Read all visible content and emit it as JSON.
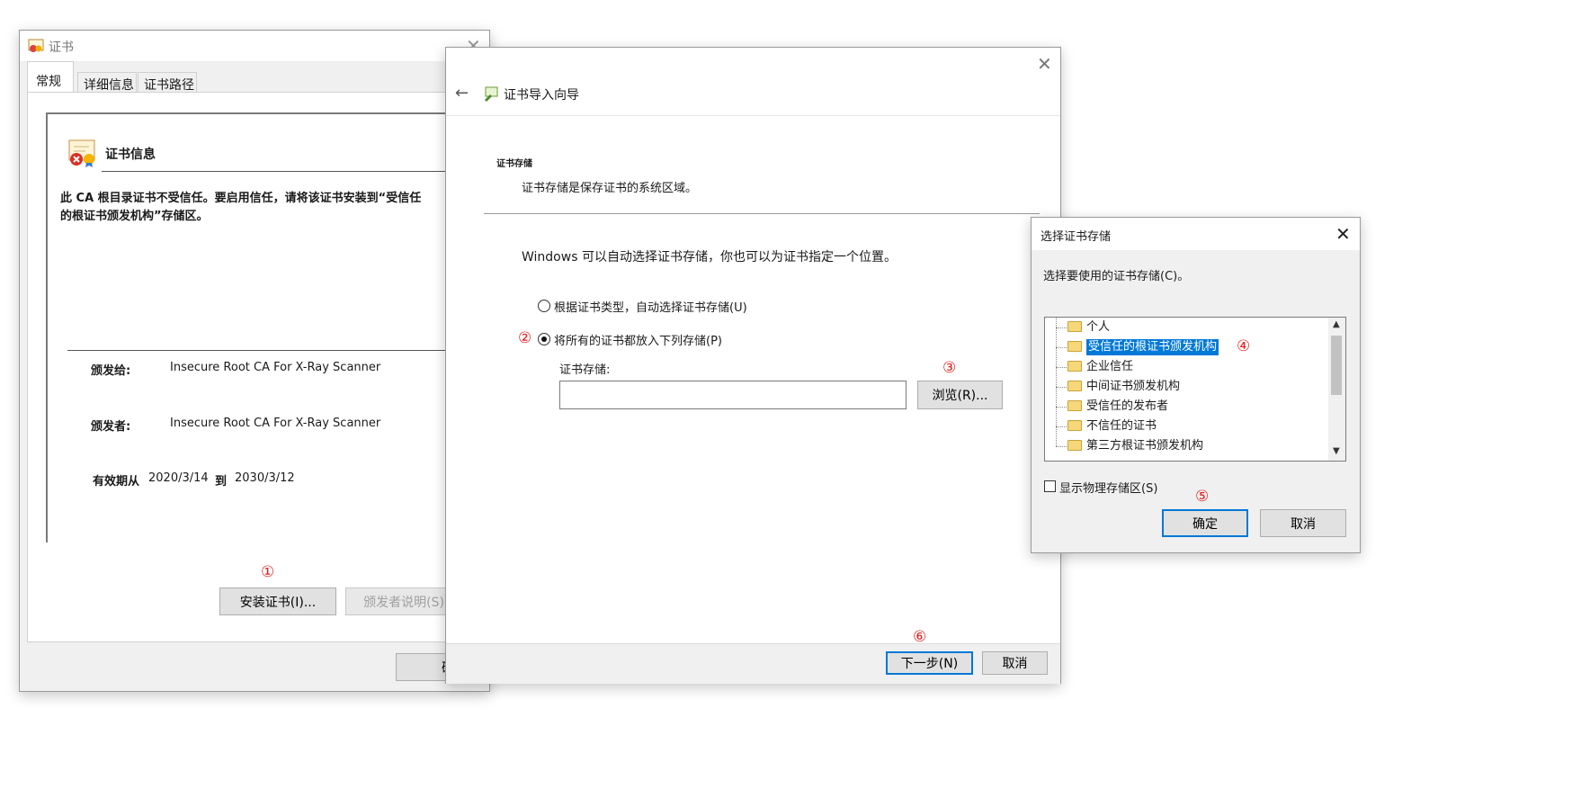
{
  "cert_window": {
    "title": "证书",
    "tabs": [
      "常规",
      "详细信息",
      "证书路径"
    ],
    "heading": "证书信息",
    "warning": "此 CA 根目录证书不受信任。要启用信任，请将该证书安装到“受信任的根证书颁发机构”存储区。",
    "issued_to_label": "颁发给:",
    "issued_to_value": "Insecure Root CA For X-Ray Scanner",
    "issued_by_label": "颁发者:",
    "issued_by_value": "Insecure Root CA For X-Ray Scanner",
    "valid_from_label": "有效期从",
    "valid_from": "2020/3/14",
    "valid_to_label": "到",
    "valid_to": "2030/3/12",
    "install_button": "安装证书(I)...",
    "issuer_statement_button": "颁发者说明(S)",
    "ok_button": "确定",
    "step_marker": "①"
  },
  "wizard": {
    "title": "证书导入向导",
    "section_title": "证书存储",
    "section_desc": "证书存储是保存证书的系统区域。",
    "intro": "Windows 可以自动选择证书存储，你也可以为证书指定一个位置。",
    "radio_auto": "根据证书类型，自动选择证书存储(U)",
    "radio_manual": "将所有的证书都放入下列存储(P)",
    "store_label": "证书存储:",
    "store_value": "",
    "browse_button": "浏览(R)...",
    "next_button": "下一步(N)",
    "cancel_button": "取消",
    "step2": "②",
    "step3": "③",
    "step6": "⑥"
  },
  "select_store": {
    "title": "选择证书存储",
    "prompt": "选择要使用的证书存储(C)。",
    "items": [
      "个人",
      "受信任的根证书颁发机构",
      "企业信任",
      "中间证书颁发机构",
      "受信任的发布者",
      "不信任的证书",
      "第三方根证书颁发机构"
    ],
    "selected_index": 1,
    "show_physical": "显示物理存储区(S)",
    "ok_button": "确定",
    "cancel_button": "取消",
    "step4": "④",
    "step5": "⑤"
  },
  "colors": {
    "accent": "#0078d7",
    "selection": "#0078d7",
    "marker": "#e02020"
  }
}
